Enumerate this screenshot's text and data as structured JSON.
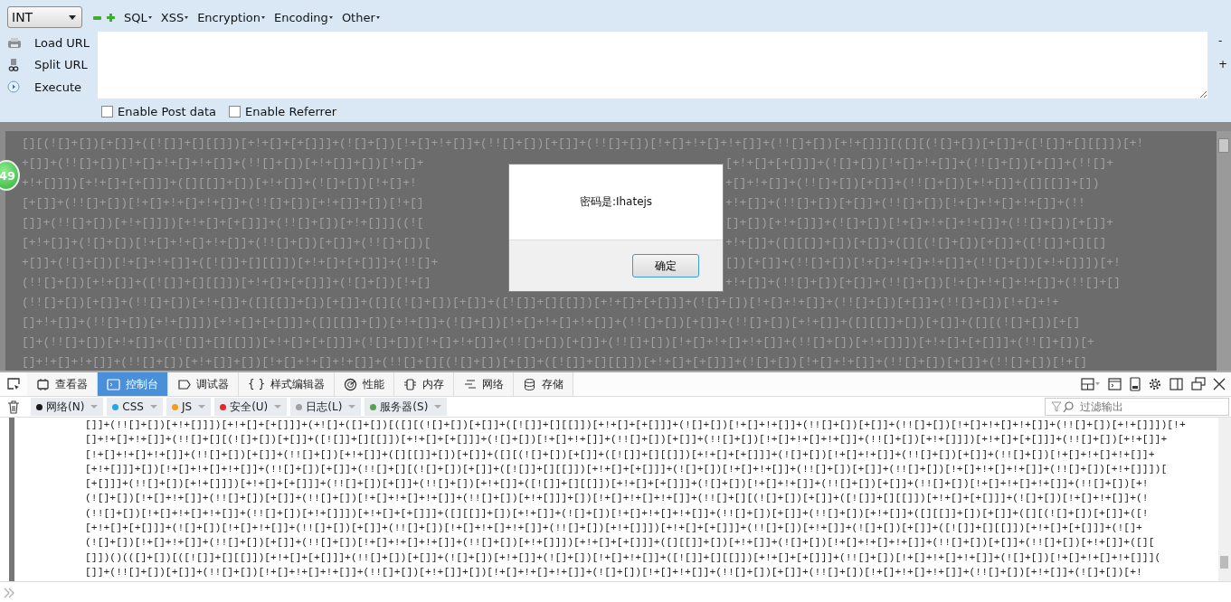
{
  "hackbar": {
    "dropdown": "INT",
    "menus": [
      "SQL",
      "XSS",
      "Encryption",
      "Encoding",
      "Other"
    ],
    "actions": [
      {
        "label": "Load URL",
        "kind": "load"
      },
      {
        "label": "Split URL",
        "kind": "split"
      },
      {
        "label": "Execute",
        "kind": "execute"
      }
    ],
    "side_buttons": [
      "-",
      "+"
    ],
    "checkboxes": [
      {
        "label": "Enable Post data",
        "checked": false
      },
      {
        "label": "Enable Referrer",
        "checked": false
      }
    ]
  },
  "page": {
    "badge": "49",
    "lines": [
      {
        "left": "[][(![]+[])[+[]]+([![]]+[][[]])[+!+[]+[+[]]]+(![]+[])[!+[]+!+[]]+(!![]+[])[+[]]+(!![]+[])[!+[]+!+[]+!+[]]+(!![]+[])[+!+[]]][([][(![]+[])[+[]]+([![]]+[][[]])[+!"
      },
      {
        "left": "+[]]+(!![]+[])[!+[]+!+[]+!+[]]+(!![]+[])[+!+[]]+[])[!+[]+",
        "right": "[+!+[]+[+[]]]+(![]+[])[!+[]+!+[]]+(!![]+[])[+[]]+(!![]+"
      },
      {
        "left": "+!+[]]])[+!+[]+[+[]]]+([][[]]+[])[+!+[]]+(![]+[])[!+[]+!",
        "right": "+[]+!+[]]+(!![]+[])[+[]]+(!![]+[])[+!+[]]+([][[]]+[])"
      },
      {
        "left": "[+[]]+(!![]+[])[!+[]+!+[]+!+[]]+(!![]+[])[+!+[]]+[])[!+[]",
        "right": "+!+[]]+(!![]+[])[+[]]+(!![]+[])[!+[]+!+[]+!+[]]+(!!"
      },
      {
        "left": "[]]+(!![]+[])[+!+[]]])[+!+[]+[+[]]]+(!![]+[])[+!+[]]]((![",
        "right": "[]+[])[+!+[]]]+(![]+[])[!+[]+!+[]+!+[]]+(!![]+[])[+[]]+"
      },
      {
        "left": "[+!+[]]+(![]+[])[!+[]+!+[]+!+[]]+(!![]+[])[+[]]+(!![]+[])[",
        "right": "+!+[]]+([][[]]+[])[+[]]+([][(![]+[])[+[]]+([![]]+[][[]"
      },
      {
        "left": "+[]]+(![]+[])[!+[]+!+[]]+([![]]+[][[]])[+!+[]+[+[]]]+(!![]+",
        "right": "[])[+[]]+(!![]+[])[!+[]+!+[]+!+[]]+(!![]+[])[+!+[]]])[+!"
      },
      {
        "left": "(!![]+[])[+!+[]]+([![]]+[][[]])[+!+[]+[+[]]]+(![]+[])[!+[]",
        "right": "+!+[]]+(!![]+[])[+[]]+(!![]+[])[!+[]+!+[]+!+[]]+(!![]+[]"
      },
      {
        "left": "(!![]+[])[+[]]+(!![]+[])[+!+[]]+([][[]]+[])[+[]]+([][(![]+[])[+[]]+([![]]+[][[]])[+!+[]+[+[]]]+(![]+[])[!+[]+!+[]]+(!![]+[])[+[]]+(!![]+[])[!+[]+!+"
      },
      {
        "left": "[]+!+[]]+(!![]+[])[+!+[]]])[+!+[]+[+[]]]+([][[]]+[])[+!+[]]+(![]+[])[!+[]+!+[]+!+[]]+(!![]+[])[+[]]+(!![]+[])[+!+[]]+([][[]]+[])[+[]]+([][(![]+[])[+[]"
      },
      {
        "left": "[]+(!![]+[])[+!+[]]+([![]]+[][[]])[+!+[]+[+[]]]+(![]+[])[!+[]+!+[]]+(!![]+[])[+[]]+(!![]+[])[!+[]+!+[]+!+[]]+(!![]+[])[+!+[]]])[+!+[]+[+[]]]+(!![]+[])[+"
      },
      {
        "left": "[]+!+[]+!+[]]+(!![]+[])[+!+[]]+[])[!+[]+!+[]+!+[]]+(!![]+[][(![]+[])[+[]]+([![]]+[][[]])[+!+[]+[+[]]]+(![]+[])[!+[]+!+[]]+(!![]+[])[+[]]+(!![]+[])[!+[]"
      }
    ]
  },
  "dialog": {
    "message": "密码是:Ihatejs",
    "button": "确定"
  },
  "devtools": {
    "tabs": [
      {
        "label": "查看器",
        "kind": "inspector",
        "selected": false
      },
      {
        "label": "控制台",
        "kind": "console",
        "selected": true
      },
      {
        "label": "调试器",
        "kind": "debugger",
        "selected": false
      },
      {
        "label": "样式编辑器",
        "kind": "style",
        "glyph": "{ }",
        "selected": false
      },
      {
        "label": "性能",
        "kind": "performance",
        "selected": false
      },
      {
        "label": "内存",
        "kind": "memory",
        "selected": false
      },
      {
        "label": "网络",
        "kind": "network",
        "selected": false
      },
      {
        "label": "存储",
        "kind": "storage",
        "selected": false
      }
    ],
    "filters": [
      {
        "label": "网络(N)",
        "color": "#1a1a1a"
      },
      {
        "label": "CSS",
        "color": "#1fa8e6"
      },
      {
        "label": "JS",
        "color": "#f29d1c"
      },
      {
        "label": "安全(U)",
        "color": "#e82828"
      },
      {
        "label": "日志(L)",
        "color": "#a0a0a0"
      },
      {
        "label": "服务器(S)",
        "color": "#54a14f"
      }
    ],
    "filter_field": {
      "placeholder": "过滤输出"
    },
    "console_lines": [
      "[]]+(!![]+[])[+!+[]]])[+!+[]+[+[]]]+(+![]+([]+[])[([][(![]+[])[+[]]+([![]]+[][[]])[+!+[]+[+[]]]+(![]+[])[!+[]+!+[]]+(!![]+[])[+[]]+(!![]+[])[!+[]+!+[]+!+[]]+(!![]+[])[+!+[]]])[!+",
      "[]+!+[]+!+[]]+(!![]+[][(![]+[])[+[]]+([![]]+[][[]])[+!+[]+[+[]]]+(![]+[])[!+[]+!+[]]+(!![]+[])[+[]]+(!![]+[])[!+[]+!+[]+!+[]]+(!![]+[])[+!+[]]])[+!+[]+[+[]]]+(!![]+[])[+!+[]]+",
      "[!+[]+!+[]+!+[]]+(!![]+[])[+[]]+(!![]+[])[+!+[]]+([][[]]+[])[+[]]+([][(![]+[])[+[]]+([![]]+[][[]])[+!+[]+[+[]]]+(![]+[])[!+[]+!+[]]+(!![]+[])[+[]]+(!![]+[])[!+[]+!+[]+!+[]]+",
      "[+!+[]]]+[])[!+[]+!+[]+!+[]]+(!![]+[])[+[]]+(!![]+[][(![]+[])[+[]]+([![]]+[][[]])[+!+[]+[+[]]]+(![]+[])[!+[]+!+[]]+(!![]+[])[+[]]+(!![]+[])[!+[]+!+[]+!+[]]+(!![]+[])[+!+[]]])[",
      "[+[]]]+(!![]+[])[+!+[]]])[+!+[]+[+[]]]+(!![]+[])[+[]]+(!![]+[])[+!+[]]+([![]]+[][[]])[+!+[]+[+[]]]+(![]+[])[!+[]+!+[]]+(!![]+[])[+[]]+(!![]+[])[!+[]+!+[]+!+[]]+(!![]+[])[+!",
      "(![]+[])[!+[]+!+[]]+(!![]+[])[+[]]+(!![]+[])[!+[]+!+[]+!+[]]+(!![]+[])[+!+[]]]+[])[!+[]+!+[]+!+[]]+(!![]+[][(![]+[])[+[]]+([![]]+[][[]])[+!+[]+[+[]]]+(![]+[])[!+[]+!+[]]+(!",
      "(!![]+[])[!+[]+!+[]+!+[]]+(!![]+[])[+!+[]]])[+!+[]+[+[]]]+([][[]]+[])[+!+[]]+(![]+[])[!+[]+!+[]+!+[]]+(!![]+[])[+[]]+(!![]+[])[+!+[]]+([][[]]+[])[+[]]+([][(![]+[])[+[]]+([!",
      "[+!+[]+[+[]]]+(![]+[])[!+[]+!+[]]+(!![]+[])[+[]]+(!![]+[])[!+[]+!+[]+!+[]]+(!![]+[])[+!+[]]])[+!+[]+[+[]]]+(!![]+[])[+!+[]]+(![]+[])[+[]]+([![]]+[][[]])[+!+[]+[+[]]]+(![]+",
      "(![]+[])[!+[]+!+[]]+(!![]+[])[+[]]+(!![]+[])[!+[]+!+[]+!+[]]+(!![]+[])[+!+[]]])[+!+[]+[+[]]]+([][[]]+[])[+!+[]]+(![]+[])[!+[]+!+[]+!+[]]+(!![]+[])[+[]]+(!![]+[])[+!+[]]+([][",
      "[]])()(([]+[])[([![]]+[][[]])[+!+[]+[+[]]]+(!![]+[])[+[]]+(![]+[])[+!+[]]+(![]+[])[!+[]+!+[]]+([![]]+[][[]])[+!+[]+[+[]]]+(!![]+[])[!+[]+!+[]+!+[]]+(![]+[])[!+[]+!+[]+!+[]]](",
      "[]]+(!![]+[])[+[]]+(!![]+[])[!+[]+!+[]+!+[]]+(!![]+[])[+!+[]]+[])[!+[]+!+[]+!+[]]+(![]+[])[!+[]+!+[]]+(!![]+[])[+[]]+(!![]+[])[!+[]+!+[]+!+[]]+(!![]+[])[+!+[]]+(![]+[])[+!"
    ]
  }
}
